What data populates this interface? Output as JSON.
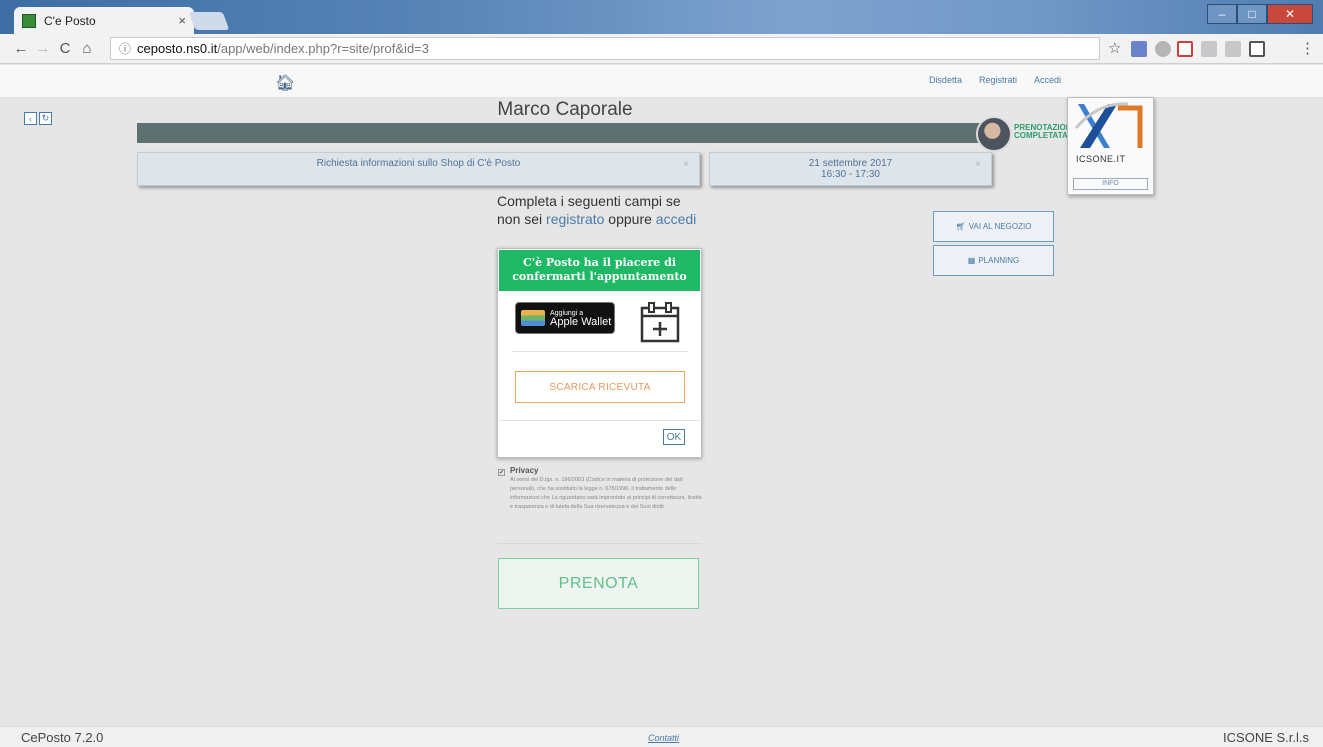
{
  "browser": {
    "tab_title": "C'e Posto",
    "tab_close": "×",
    "url_host": "ceposto.ns0.it",
    "url_path": "/app/web/index.php?r=site/prof&id=3",
    "nav": {
      "back": "←",
      "forward": "→",
      "reload": "C",
      "home": "⌂"
    },
    "window": {
      "minimize": "–",
      "maximize": "□",
      "close": "✕"
    }
  },
  "header": {
    "links": [
      "Disdetta",
      "Registrati",
      "Accedi"
    ]
  },
  "side_controls": {
    "back": "‹",
    "refresh": "↻"
  },
  "profile": {
    "name": "Marco Caporale",
    "badge_line1": "PRENOTAZIONE",
    "badge_line2": "COMPLETATA"
  },
  "logo": {
    "text": "ICSONE.IT",
    "info_label": "INFO"
  },
  "cards": {
    "service": "Richiesta informazioni sullo Shop di C'è Posto",
    "date": "21 settembre 2017",
    "time": "16:30 - 17:30",
    "close": "×"
  },
  "intro": {
    "part1": "Completa i seguenti campi se non sei ",
    "registrato": "registrato",
    "part2": " oppure ",
    "accedi": "accedi"
  },
  "side_buttons": {
    "shop": "VAI AL NEGOZIO",
    "planning": "PLANNING"
  },
  "modal": {
    "title_line1": "C'è Posto ha il piacere di",
    "title_line2": "confermarti l'appuntamento",
    "wallet_line1": "Aggiungi a",
    "wallet_line2": "Apple Wallet",
    "receipt": "SCARICA RICEVUTA",
    "ok": "OK"
  },
  "privacy": {
    "title": "Privacy",
    "checked": true,
    "text": "Ai sensi del D.lgs. n. 196/2003 (Codice in materia di protezione dei dati personali), che ha sostituito la legge n. 675/1996, il trattamento delle informazioni che La riguardano sarà improntato ai principi di correttezza, liceità e trasparenza e di tutela della Sua riservatezza e dei Suoi diritti"
  },
  "actions": {
    "book": "PRENOTA"
  },
  "footer": {
    "version": "CePosto 7.2.0",
    "contacts": "Contatti",
    "company": "ICSONE S.r.l.s"
  },
  "colors": {
    "accent_green": "#1fb865",
    "link_blue": "#4a7aa8",
    "header_bar": "#5d7270",
    "receipt_orange": "#e29a5a"
  }
}
